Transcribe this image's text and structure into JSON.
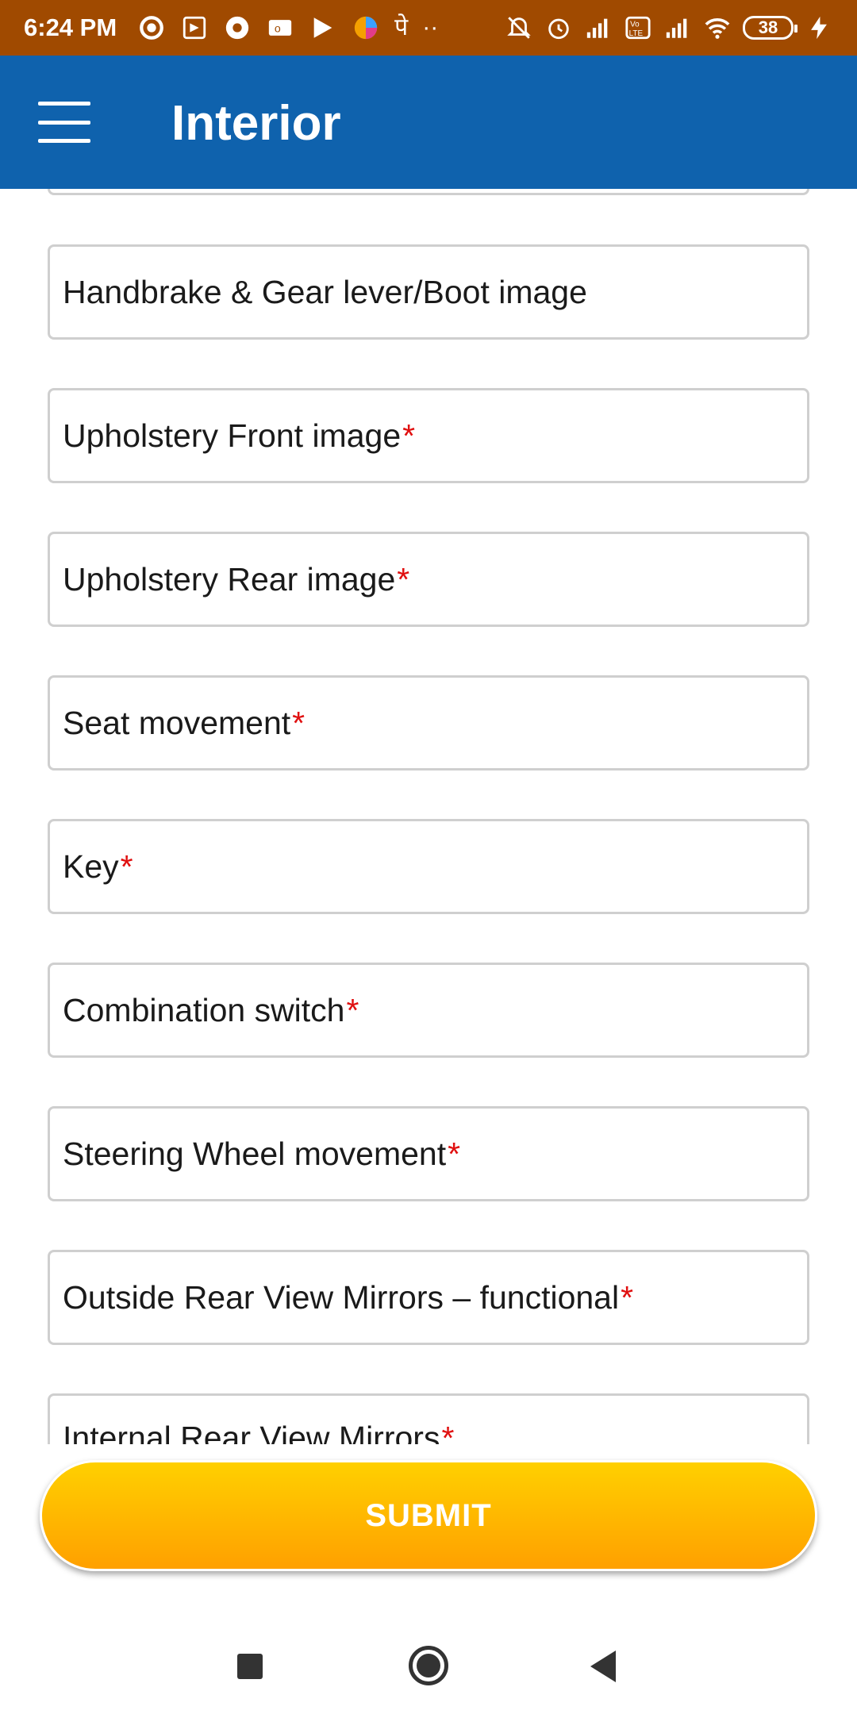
{
  "status_bar": {
    "time": "6:24 PM",
    "devanagari_glyph": "पे",
    "more_dots": "··",
    "battery": "38",
    "icons": [
      "location-ring-icon",
      "play-store-icon",
      "chrome-icon",
      "outlook-icon",
      "play-icon",
      "app-circle-icon",
      "mute-icon",
      "alarm-icon",
      "signal-icon",
      "volte-icon",
      "signal-icon",
      "wifi-icon",
      "charging-icon"
    ]
  },
  "app_bar": {
    "title": "Interior",
    "menu_icon": "hamburger-menu-icon"
  },
  "fields": [
    {
      "label": "Handbrake & Gear lever/Boot image",
      "required": ""
    },
    {
      "label": "Upholstery Front image",
      "required": "*"
    },
    {
      "label": "Upholstery Rear image",
      "required": "*"
    },
    {
      "label": "Seat movement",
      "required": "*"
    },
    {
      "label": "Key",
      "required": "*"
    },
    {
      "label": "Combination switch",
      "required": "*"
    },
    {
      "label": "Steering Wheel movement",
      "required": "*"
    },
    {
      "label": "Outside Rear View Mirrors – functional",
      "required": "*"
    },
    {
      "label": "Internal Rear View Mirrors",
      "required": "*"
    }
  ],
  "submit": {
    "label": "SUBMIT"
  },
  "colors": {
    "status_bar": "#a04a00",
    "app_bar": "#0f62ad",
    "required_mark": "#e01010",
    "submit_top": "#ffd000",
    "submit_bottom": "#ffa000"
  },
  "nav_bar": {
    "icons": [
      "recent-apps-icon",
      "home-icon",
      "back-icon"
    ]
  }
}
